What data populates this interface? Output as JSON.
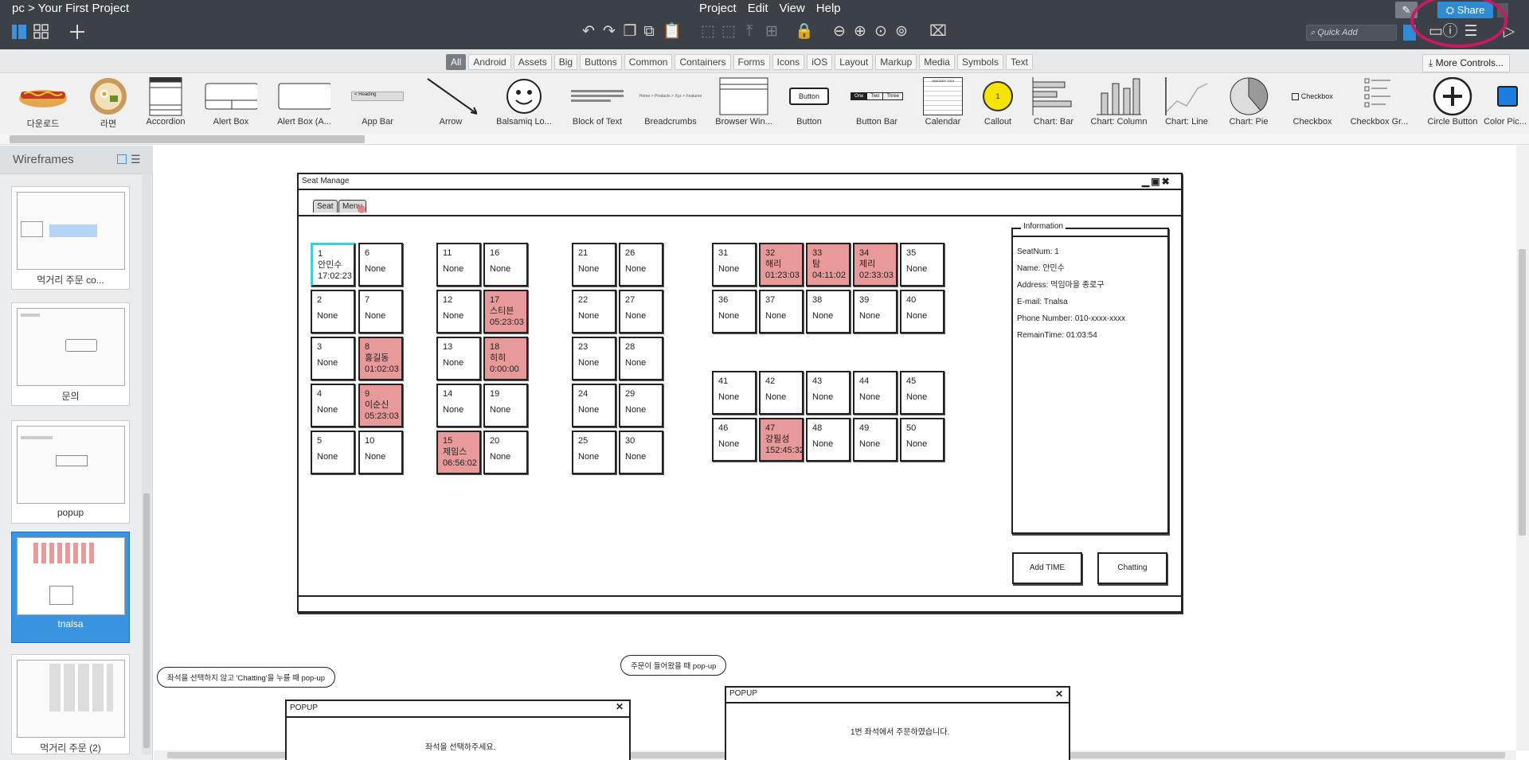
{
  "app": {
    "breadcrumb": "pc > Your First Project",
    "menu": [
      "Project",
      "Edit",
      "View",
      "Help"
    ],
    "quick_add_placeholder": "Quick Add",
    "share_label": "Share"
  },
  "categories": [
    "All",
    "Android",
    "Assets",
    "Big",
    "Buttons",
    "Common",
    "Containers",
    "Forms",
    "Icons",
    "iOS",
    "Layout",
    "Markup",
    "Media",
    "Symbols",
    "Text"
  ],
  "more_controls": "More Controls...",
  "library": [
    "다운로드",
    "라면",
    "Accordion",
    "Alert Box",
    "Alert Box (A...",
    "App Bar",
    "Arrow",
    "Balsamiq Lo...",
    "Block of Text",
    "Breadcrumbs",
    "Browser Win...",
    "Button",
    "Button Bar",
    "Calendar",
    "Callout",
    "Chart: Bar",
    "Chart: Column",
    "Chart: Line",
    "Chart: Pie",
    "Checkbox",
    "Checkbox Gr...",
    "Circle Button",
    "Color Pic..."
  ],
  "library_thumb_text": {
    "button": "Button",
    "checkbox": "Checkbox",
    "button_bar": [
      "One",
      "Two",
      "Three"
    ],
    "calendar_month": "JANUARY 2019",
    "callout": "1",
    "breadcrumbs": "Home > Products > Xyz > Features",
    "app_bar": "< Heading"
  },
  "sidebar": {
    "title": "Wireframes",
    "items": [
      "먹거리 주문 co...",
      "문의",
      "popup",
      "tnalsa",
      "먹거리 주문 (2)"
    ]
  },
  "wireframe": {
    "window_title": "Seat Manage",
    "tabs": [
      "Seat",
      "Menu"
    ],
    "seats": [
      {
        "num": "1",
        "name": "안민수",
        "time": "17:02:23",
        "occupied": false,
        "selected": true
      },
      {
        "num": "2",
        "name": "",
        "time": "None",
        "occupied": false
      },
      {
        "num": "3",
        "name": "",
        "time": "None",
        "occupied": false
      },
      {
        "num": "4",
        "name": "",
        "time": "None",
        "occupied": false
      },
      {
        "num": "5",
        "name": "",
        "time": "None",
        "occupied": false
      },
      {
        "num": "6",
        "name": "",
        "time": "None",
        "occupied": false
      },
      {
        "num": "7",
        "name": "",
        "time": "None",
        "occupied": false
      },
      {
        "num": "8",
        "name": "홍길동",
        "time": "01:02:03",
        "occupied": true
      },
      {
        "num": "9",
        "name": "이순신",
        "time": "05:23:03",
        "occupied": true
      },
      {
        "num": "10",
        "name": "",
        "time": "None",
        "occupied": false
      },
      {
        "num": "11",
        "name": "",
        "time": "None",
        "occupied": false
      },
      {
        "num": "12",
        "name": "",
        "time": "None",
        "occupied": false
      },
      {
        "num": "13",
        "name": "",
        "time": "None",
        "occupied": false
      },
      {
        "num": "14",
        "name": "",
        "time": "None",
        "occupied": false
      },
      {
        "num": "15",
        "name": "제임스",
        "time": "06:56:02",
        "occupied": true
      },
      {
        "num": "16",
        "name": "",
        "time": "None",
        "occupied": false
      },
      {
        "num": "17",
        "name": "스티븐",
        "time": "05:23:03",
        "occupied": true
      },
      {
        "num": "18",
        "name": "히히",
        "time": "0:00:00",
        "occupied": true
      },
      {
        "num": "19",
        "name": "",
        "time": "None",
        "occupied": false
      },
      {
        "num": "20",
        "name": "",
        "time": "None",
        "occupied": false
      },
      {
        "num": "21",
        "name": "",
        "time": "None",
        "occupied": false
      },
      {
        "num": "22",
        "name": "",
        "time": "None",
        "occupied": false
      },
      {
        "num": "23",
        "name": "",
        "time": "None",
        "occupied": false
      },
      {
        "num": "24",
        "name": "",
        "time": "None",
        "occupied": false
      },
      {
        "num": "25",
        "name": "",
        "time": "None",
        "occupied": false
      },
      {
        "num": "26",
        "name": "",
        "time": "None",
        "occupied": false
      },
      {
        "num": "27",
        "name": "",
        "time": "None",
        "occupied": false
      },
      {
        "num": "28",
        "name": "",
        "time": "None",
        "occupied": false
      },
      {
        "num": "29",
        "name": "",
        "time": "None",
        "occupied": false
      },
      {
        "num": "30",
        "name": "",
        "time": "None",
        "occupied": false
      },
      {
        "num": "31",
        "name": "",
        "time": "None",
        "occupied": false
      },
      {
        "num": "32",
        "name": "해리",
        "time": "01:23:03",
        "occupied": true
      },
      {
        "num": "33",
        "name": "탐",
        "time": "04:11:02",
        "occupied": true
      },
      {
        "num": "34",
        "name": "제리",
        "time": "02:33:03",
        "occupied": true
      },
      {
        "num": "35",
        "name": "",
        "time": "None",
        "occupied": false
      },
      {
        "num": "36",
        "name": "",
        "time": "None",
        "occupied": false
      },
      {
        "num": "37",
        "name": "",
        "time": "None",
        "occupied": false
      },
      {
        "num": "38",
        "name": "",
        "time": "None",
        "occupied": false
      },
      {
        "num": "39",
        "name": "",
        "time": "None",
        "occupied": false
      },
      {
        "num": "40",
        "name": "",
        "time": "None",
        "occupied": false
      },
      {
        "num": "41",
        "name": "",
        "time": "None",
        "occupied": false
      },
      {
        "num": "42",
        "name": "",
        "time": "None",
        "occupied": false
      },
      {
        "num": "43",
        "name": "",
        "time": "None",
        "occupied": false
      },
      {
        "num": "44",
        "name": "",
        "time": "None",
        "occupied": false
      },
      {
        "num": "45",
        "name": "",
        "time": "None",
        "occupied": false
      },
      {
        "num": "46",
        "name": "",
        "time": "None",
        "occupied": false
      },
      {
        "num": "47",
        "name": "강필성",
        "time": "152:45:32",
        "occupied": true
      },
      {
        "num": "48",
        "name": "",
        "time": "None",
        "occupied": false
      },
      {
        "num": "49",
        "name": "",
        "time": "None",
        "occupied": false
      },
      {
        "num": "50",
        "name": "",
        "time": "None",
        "occupied": false
      }
    ],
    "info": {
      "title": "Information",
      "lines": [
        "SeatNum: 1",
        "Name: 안민수",
        "Address: 먹임마을 종로구",
        "E-mail: Tnalsa",
        "Phone Number: 010-xxxx-xxxx",
        "RemainTime: 01:03:54"
      ]
    },
    "buttons": {
      "add_time": "Add TIME",
      "chatting": "Chatting"
    },
    "callouts": [
      "좌석을 선택하지 않고 'Chatting'을 누를 때 pop-up",
      "주문이 들어왔을 때 pop-up"
    ],
    "popups": [
      {
        "title": "POPUP",
        "message": "좌석을 선택하주세요."
      },
      {
        "title": "POPUP",
        "message": "1번 좌석에서 주문하였습니다."
      }
    ]
  }
}
